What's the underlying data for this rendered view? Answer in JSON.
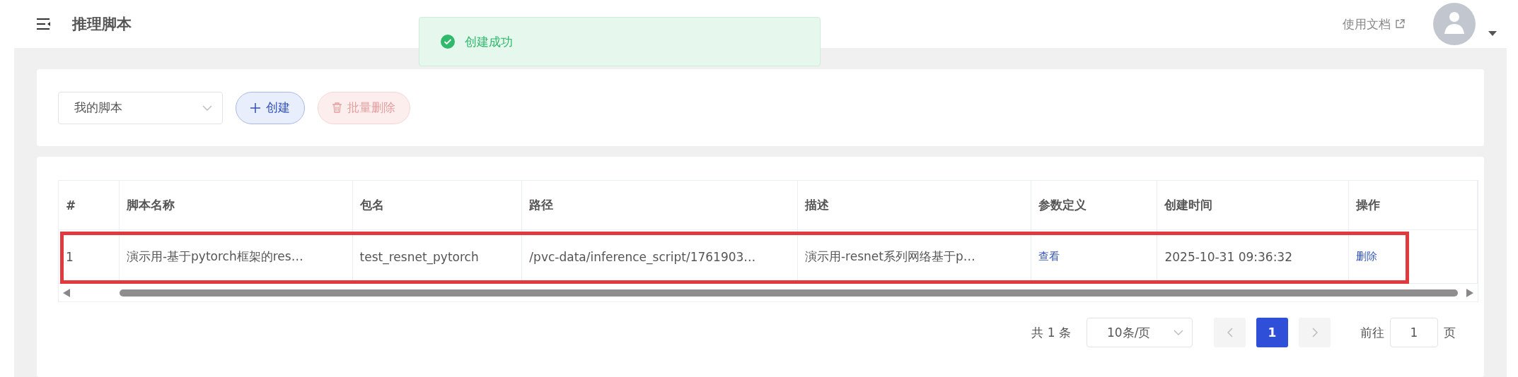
{
  "header": {
    "title": "推理脚本",
    "docs_link": "使用文档"
  },
  "toast": {
    "message": "创建成功"
  },
  "toolbar": {
    "scope_select": "我的脚本",
    "create_button": "创建",
    "batch_delete_button": "批量删除",
    "batch_delete_disabled": true
  },
  "table": {
    "columns": [
      "#",
      "脚本名称",
      "包名",
      "路径",
      "描述",
      "参数定义",
      "创建时间",
      "操作"
    ],
    "rows": [
      {
        "highlighted": true,
        "cells": [
          "1",
          "演示用-基于pytorch框架的res…",
          "test_resnet_pytorch",
          "/pvc-data/inference_script/1761903…",
          "演示用-resnet系列网络基于p…",
          "查看",
          "2025-10-31 09:36:32",
          "删除"
        ]
      }
    ]
  },
  "pagination": {
    "total": "共 1 条",
    "page_size": "10条/页",
    "pages": [
      {
        "label": "1",
        "selected": true
      }
    ],
    "goto_label": "前往",
    "goto_value": "1",
    "page_suffix": "页"
  }
}
